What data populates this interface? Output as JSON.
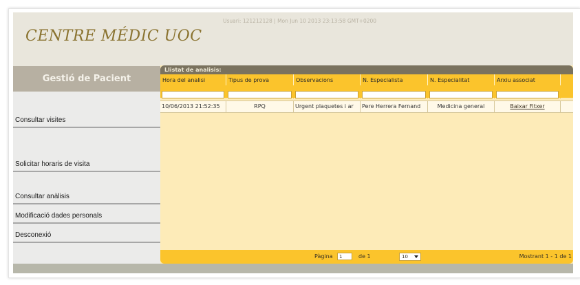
{
  "header": {
    "logo": "CENTRE MÉDIC UOC",
    "user_info": "Usuari: 121212128 | Mon Jun 10 2013 23:13:58 GMT+0200"
  },
  "sidebar": {
    "title": "Gestió de Pacient",
    "items": [
      {
        "label": "Consultar visites"
      },
      {
        "label": "Solicitar horaris de visita"
      },
      {
        "label": "Consultar anàlisis"
      },
      {
        "label": "Modificació dades personals"
      },
      {
        "label": "Desconexió"
      }
    ]
  },
  "grid": {
    "caption": "Llistat de analisis:",
    "columns": [
      "Hora del analisi",
      "Tipus de prova",
      "Observacions",
      "N. Especialista",
      "N. Especialitat",
      "Arxiu associat"
    ],
    "rows": [
      {
        "hora": "10/06/2013 21:52:35",
        "tipus": "RPQ",
        "observacions": "Urgent plaquetes i ar",
        "especialista": "Pere Herrera Fernand",
        "especialitat": "Medicina general",
        "arxiu": "Baixar Fitxer"
      }
    ]
  },
  "pager": {
    "page_label": "Pàgina",
    "page_value": "1",
    "of_label": "de 1",
    "rows_per_page": "10",
    "summary": "Mostrant 1 - 1 de 1"
  },
  "colors": {
    "accent": "#fbc42c",
    "caption_bg": "#7a725e",
    "logo": "#8a7330"
  },
  "icons": {
    "select_arrow": "chevron-down-icon"
  }
}
